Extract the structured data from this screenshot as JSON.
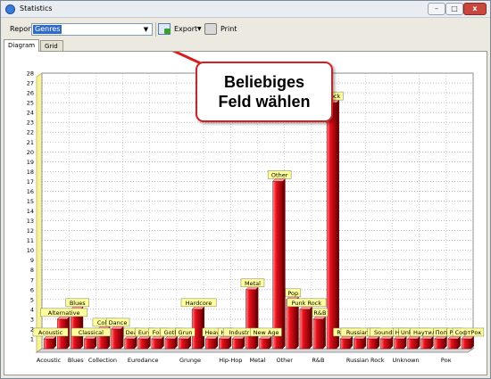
{
  "window": {
    "title": "Statistics",
    "close": "x",
    "minimize": "–",
    "maximize": "□"
  },
  "toolbar": {
    "report_label": "Report",
    "report_value": "Genres",
    "export_label": "Export",
    "print_label": "Print",
    "export_icon": "export-icon",
    "print_icon": "printer-icon"
  },
  "tabs": [
    {
      "label": "Diagram",
      "active": true
    },
    {
      "label": "Grid",
      "active": false
    }
  ],
  "callout": {
    "line1": "Beliebiges",
    "line2": "Feld wählen",
    "color": "#d42020"
  },
  "chart_data": {
    "type": "bar",
    "ylim": [
      0,
      28
    ],
    "grid": true,
    "bar_color": "#e8101c",
    "label_bg": "#ffff9c",
    "yticks": [
      1,
      2,
      3,
      4,
      5,
      6,
      7,
      8,
      9,
      10,
      11,
      12,
      13,
      14,
      15,
      16,
      17,
      18,
      19,
      20,
      21,
      22,
      23,
      24,
      25,
      26,
      27,
      28
    ],
    "categories": [
      "Acoustic",
      "Alternative",
      "Blues",
      "Classical",
      "Collection",
      "Dance",
      "Dea",
      "Euro",
      "Folk",
      "Gothi",
      "Grun",
      "Hardcore",
      "Heav",
      "Hip",
      "Industr",
      "Metal",
      "New Age",
      "Other",
      "Pop",
      "Punk Rock",
      "R&B",
      "Rock",
      "Rock &",
      "Russian R",
      "S",
      "Soundtra",
      "Hay",
      "Unknown",
      "Наутилус",
      "Поп",
      "Рок",
      "СофтРок"
    ],
    "values": [
      1,
      3,
      4,
      1,
      2,
      2,
      1,
      1,
      1,
      1,
      1,
      4,
      1,
      1,
      1,
      6,
      1,
      17,
      5,
      4,
      3,
      25,
      1,
      1,
      1,
      1,
      1,
      1,
      1,
      1,
      1,
      1
    ],
    "bar_labels": [
      "Acoustic",
      "Alternative",
      "Blues",
      "Classical",
      "Colle",
      "Dance",
      "Dea",
      "Euro",
      "Folk",
      "Gothi",
      "Grun",
      "Hardcore",
      "Heav",
      "Hip",
      "Industr",
      "Metal",
      "New Age",
      "Other",
      "Pop",
      "Punk Rock",
      "R&B",
      "Rock",
      "Rock &",
      "Russian R",
      "S",
      "Soundtra",
      "Hay",
      "Unknown",
      "Наутилус",
      "Поп",
      "Рок",
      "СофтРок"
    ],
    "xtick_labels": [
      {
        "label": "Acoustic",
        "at": 0
      },
      {
        "label": "Blues",
        "at": 2
      },
      {
        "label": "Collection",
        "at": 4
      },
      {
        "label": "Eurodance",
        "at": 7
      },
      {
        "label": "Grunge",
        "at": 10.5
      },
      {
        "label": "Hip-Hop",
        "at": 13.5
      },
      {
        "label": "Metal",
        "at": 15.5
      },
      {
        "label": "Other",
        "at": 17.5
      },
      {
        "label": "R&B",
        "at": 20
      },
      {
        "label": "Russian Rock",
        "at": 23.5
      },
      {
        "label": "Unknown",
        "at": 26.5
      },
      {
        "label": "Рок",
        "at": 29.5
      }
    ]
  }
}
